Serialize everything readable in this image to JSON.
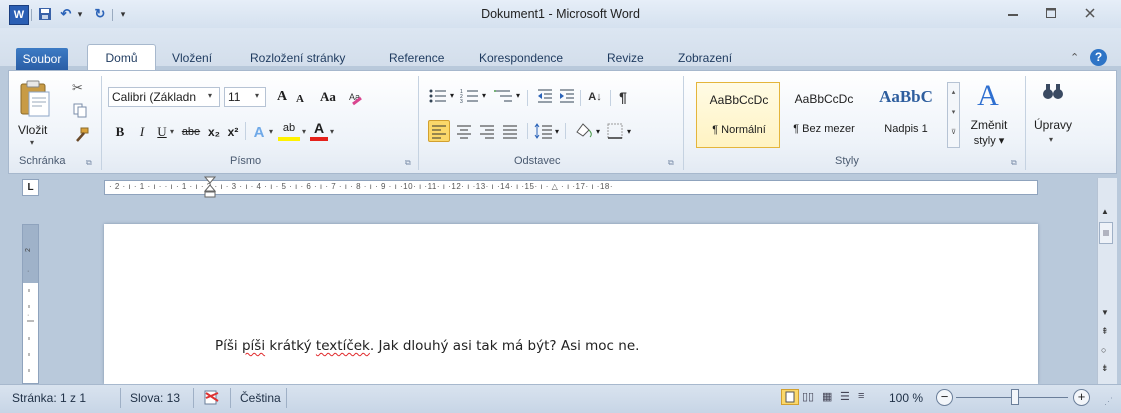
{
  "window": {
    "title": "Dokument1  -  Microsoft Word",
    "qat": {
      "word_icon": "W",
      "undo_arrow": "▾",
      "redo": "↻",
      "customize": "▾"
    }
  },
  "tabs": {
    "file": "Soubor",
    "items": [
      "Domů",
      "Vložení",
      "Rozložení stránky",
      "Reference",
      "Korespondence",
      "Revize",
      "Zobrazení"
    ]
  },
  "ribbon": {
    "clipboard": {
      "paste": "Vložit",
      "group_label": "Schránka"
    },
    "font": {
      "name": "Calibri (Základn",
      "size": "11",
      "grow": "A",
      "shrink": "A",
      "change_case": "Aa",
      "bold": "B",
      "italic": "I",
      "underline": "U",
      "strike": "abe",
      "subscript": "x₂",
      "superscript": "x²",
      "effects": "A",
      "highlight": "ab",
      "color": "A",
      "group_label": "Písmo"
    },
    "paragraph": {
      "sort": "A↓",
      "pilcrow": "¶",
      "group_label": "Odstavec"
    },
    "styles": {
      "items": [
        {
          "preview": "AaBbCcDc",
          "name": "¶ Normální"
        },
        {
          "preview": "AaBbCcDc",
          "name": "¶ Bez mezer"
        },
        {
          "preview": "AaBbC",
          "name": "Nadpis 1"
        }
      ],
      "change_styles_line1": "Změnit",
      "change_styles_line2": "styly ▾",
      "group_label": "Styly"
    },
    "editing": {
      "label": "Úpravy"
    }
  },
  "ruler": {
    "ticks": "· 2 · ı · 1 · ı ·   · ı · 1 · ı · 2 · ı · 3 · ı · 4 · ı · 5 · ı · 6 · ı · 7 · ı · 8 · ı · 9 · ı ·10· ı ·11· ı ·12· ı ·13· ı ·14· ı ·15· ı · △ · ı ·17· ı ·18·",
    "tab_selector": "L"
  },
  "document": {
    "text_parts": [
      "Píši ",
      "píši",
      " krátký ",
      "textíček",
      ". Jak dlouhý asi tak má být? Asi moc ne."
    ]
  },
  "statusbar": {
    "page": "Stránka: 1 z 1",
    "words": "Slova: 13",
    "language": "Čeština",
    "zoom": "100 %",
    "zoom_minus": "−",
    "zoom_plus": "+"
  },
  "colors": {
    "file_tab": "#2a5ea6",
    "accent": "#3d7bc4",
    "spell_error": "#e0292b",
    "help": "#2e74c6"
  }
}
